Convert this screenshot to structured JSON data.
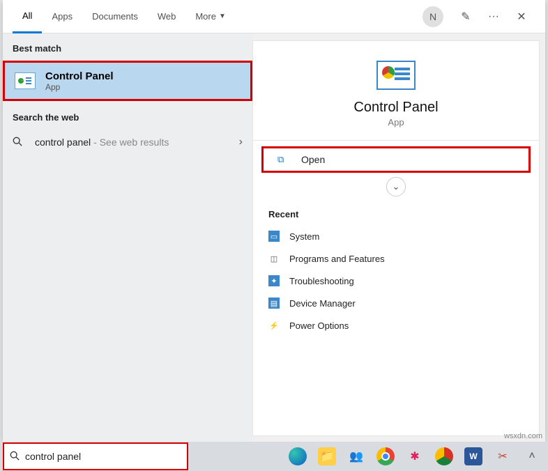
{
  "header": {
    "tabs": {
      "all": "All",
      "apps": "Apps",
      "documents": "Documents",
      "web": "Web",
      "more": "More"
    },
    "avatar_initial": "N"
  },
  "left": {
    "best_match_heading": "Best match",
    "result": {
      "title": "Control Panel",
      "subtitle": "App"
    },
    "search_web_heading": "Search the web",
    "web_primary": "control panel",
    "web_secondary": " - See web results"
  },
  "right": {
    "hero_title": "Control Panel",
    "hero_sub": "App",
    "open_label": "Open",
    "recent_heading": "Recent",
    "recent": {
      "system": "System",
      "programs": "Programs and Features",
      "troubleshooting": "Troubleshooting",
      "device_manager": "Device Manager",
      "power": "Power Options"
    }
  },
  "searchbox": {
    "value": "control panel"
  },
  "watermark": "wsxdn.com"
}
